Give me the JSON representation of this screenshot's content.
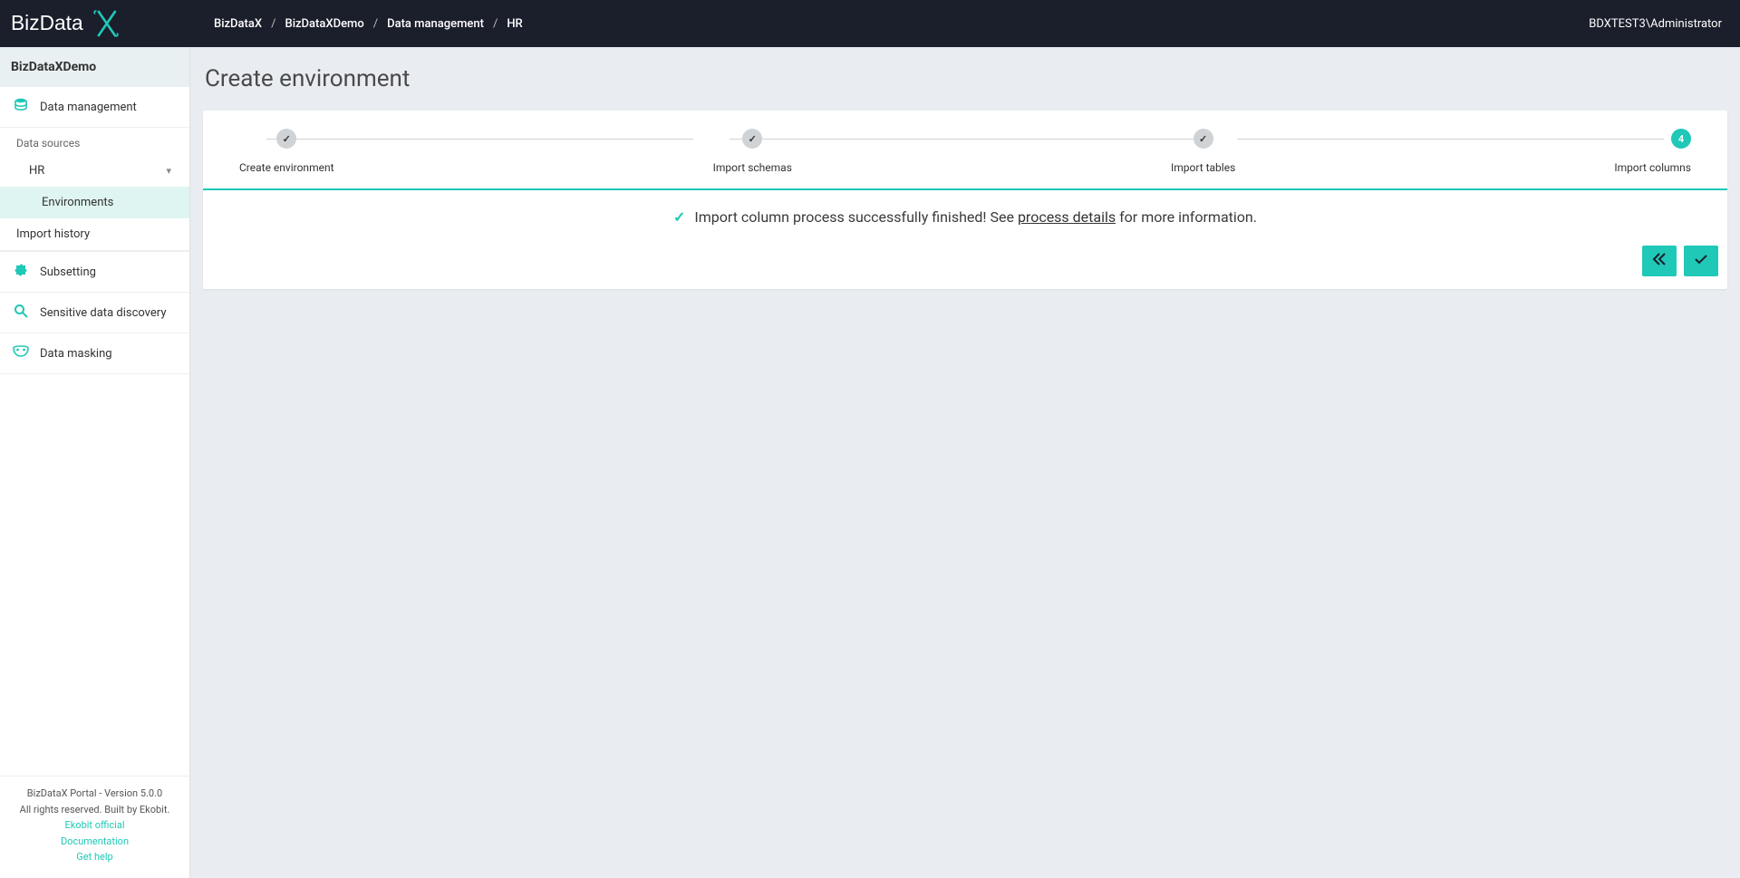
{
  "header": {
    "logo_text": "BizDataX",
    "breadcrumbs": [
      "BizDataX",
      "BizDataXDemo",
      "Data management",
      "HR"
    ],
    "user": "BDXTEST3\\Administrator"
  },
  "sidebar": {
    "project": "BizDataXDemo",
    "nav": {
      "data_management": "Data management",
      "data_sources_label": "Data sources",
      "hr": "HR",
      "environments": "Environments",
      "import_history": "Import history",
      "subsetting": "Subsetting",
      "sensitive": "Sensitive data discovery",
      "masking": "Data masking"
    },
    "footer": {
      "line1": "BizDataX Portal - Version 5.0.0",
      "line2": "All rights reserved. Built by Ekobit.",
      "link1": "Ekobit official",
      "link2": "Documentation",
      "link3": "Get help"
    }
  },
  "main": {
    "title": "Create environment",
    "steps": [
      {
        "label": "Create environment",
        "done": true
      },
      {
        "label": "Import schemas",
        "done": true
      },
      {
        "label": "Import tables",
        "done": true
      },
      {
        "label": "Import columns",
        "done": false,
        "badge": "4",
        "active": true
      }
    ],
    "message_pre": "Import column process successfully finished! See ",
    "message_link": "process details",
    "message_post": " for more information."
  }
}
